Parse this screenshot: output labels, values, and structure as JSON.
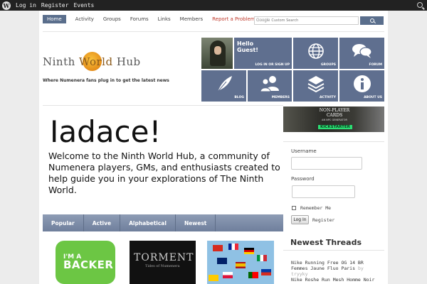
{
  "adminbar": {
    "links": [
      "Log in",
      "Register",
      "Events"
    ]
  },
  "nav": {
    "items": [
      "Home",
      "Activity",
      "Groups",
      "Forums",
      "Links",
      "Members",
      "Report a Problem"
    ],
    "search_placeholder": "Custom Search",
    "search_brand": "Google"
  },
  "logo": {
    "part1": "Ninth ",
    "part2": "World",
    "part3": " Hub"
  },
  "tagline": "Where Numenera fans plug in to get the latest news",
  "tiles": {
    "hello": "Hello Guest!",
    "login": "Log in or sign up",
    "groups": "Groups",
    "forum": "Forum",
    "blog": "Blog",
    "members": "Members",
    "activity": "Activity",
    "about": "About us"
  },
  "welcome": {
    "title": "Iadace!",
    "text": "Welcome to the Ninth World Hub, a community of Numenera players, GMs, and enthusiasts created to help guide you in your explorations of The Ninth World."
  },
  "tabs": [
    "Popular",
    "Active",
    "Alphabetical",
    "Newest"
  ],
  "groups": {
    "backer_1": "I'M A",
    "backer_2": "BACKER",
    "torment_1": "TORMENT",
    "torment_2": "Tides of Numenera"
  },
  "banner": {
    "title": "NON-PLAYER CARDS",
    "subtitle": "AN NPC GENERATOR",
    "ks": "KICKSTARTER"
  },
  "login": {
    "username_label": "Username",
    "password_label": "Password",
    "remember_label": "Remember Me",
    "login_button": "Log In",
    "register_link": "Register"
  },
  "threads": {
    "heading": "Newest Threads",
    "items": [
      {
        "title": "Nike Running Free OG 14 BR Femmes Jaune Fluo Paris",
        "by": "by tryyky"
      },
      {
        "title": "Nike Roshe Run Mesh Homme Noir",
        "by": ""
      }
    ]
  }
}
